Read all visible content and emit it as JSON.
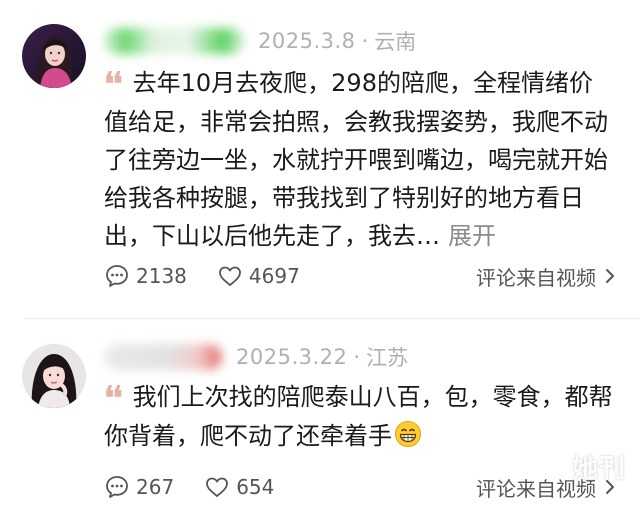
{
  "comments": [
    {
      "date": "2025.3.8",
      "separator": "·",
      "region": "云南",
      "quote_mark": "❛❛",
      "text": "去年10月去夜爬，298的陪爬，全程情绪价值给足，非常会拍照，会教我摆姿势，我爬不动了往旁边一坐，水就拧开喂到嘴边，喝完就开始给我各种按腿，带我找到了特别好的地方看日出，下山以后他先走了，我去…",
      "expand_label": "展开",
      "reply_count": "2138",
      "like_count": "4697",
      "video_link_label": "评论来自视频",
      "avatar_icon": "woman-portrait-avatar"
    },
    {
      "date": "2025.3.22",
      "separator": "·",
      "region": "江苏",
      "quote_mark": "❛❛",
      "text": "我们上次找的陪爬泰山八百，包，零食，都帮你背着，爬不动了还牵着手",
      "emoji_icon": "grinning-face-icon",
      "reply_count": "267",
      "like_count": "654",
      "video_link_label": "评论来自视频",
      "avatar_icon": "woman-portrait-avatar"
    }
  ],
  "watermark": "她刊",
  "colors": {
    "meta_gray": "#b0b0b0",
    "quote_color": "#e5b3a3",
    "text": "#1a1a1a"
  }
}
